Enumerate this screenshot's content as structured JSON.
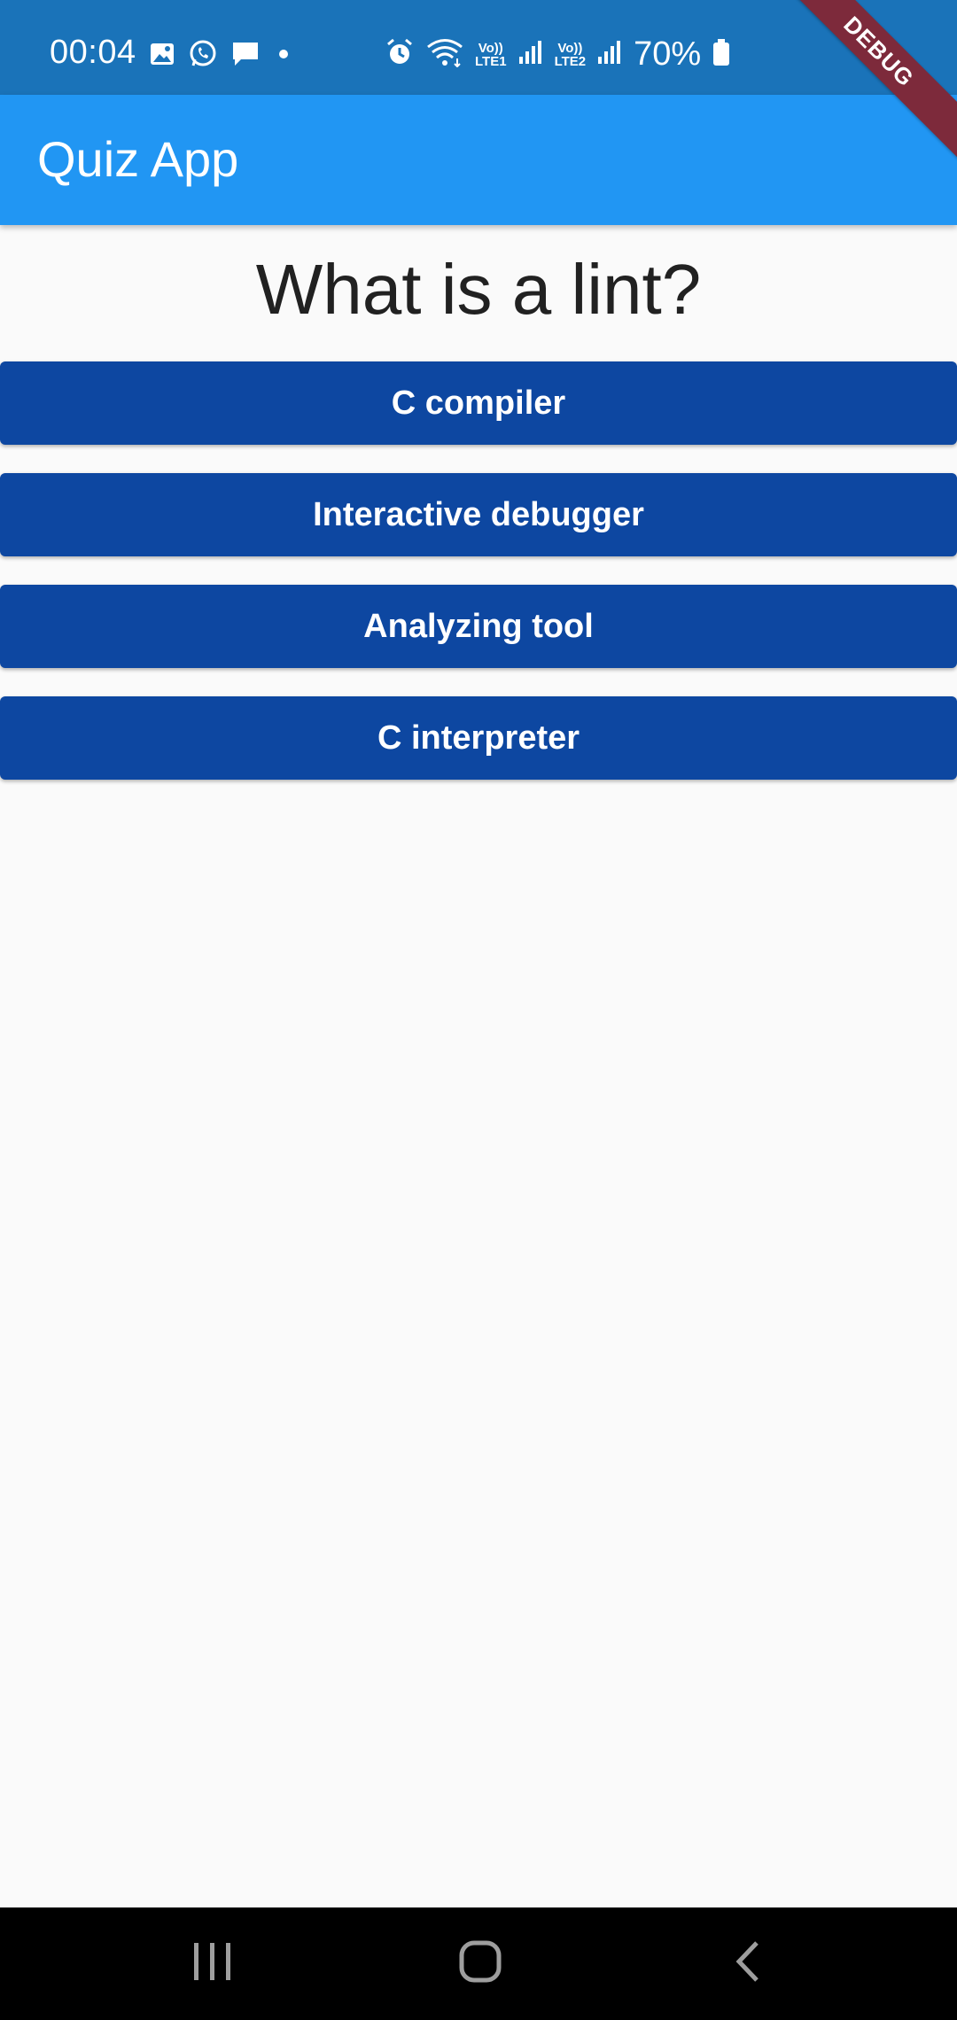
{
  "status_bar": {
    "time": "00:04",
    "battery": "70%",
    "lte1_top": "Vo))",
    "lte1_bottom": "LTE1",
    "lte2_top": "Vo))",
    "lte2_bottom": "LTE2",
    "icons": [
      "image-icon",
      "whatsapp-icon",
      "message-icon",
      "dot-icon",
      "alarm-icon",
      "wifi-icon",
      "signal-icon",
      "signal-icon",
      "battery-icon"
    ]
  },
  "debug_banner": "DEBUG",
  "app_bar": {
    "title": "Quiz App"
  },
  "quiz": {
    "question": "What is a lint?",
    "answers": [
      {
        "label": "C compiler"
      },
      {
        "label": "Interactive debugger"
      },
      {
        "label": "Analyzing tool"
      },
      {
        "label": "C interpreter"
      }
    ]
  },
  "nav_bar": {
    "buttons": [
      "recent-apps-icon",
      "home-icon",
      "back-icon"
    ]
  },
  "colors": {
    "status_bar": "#1a73b9",
    "app_bar": "#2196f3",
    "answer_button": "#0d47a1",
    "debug_banner": "#7d2a3b",
    "background": "#fafafa"
  }
}
